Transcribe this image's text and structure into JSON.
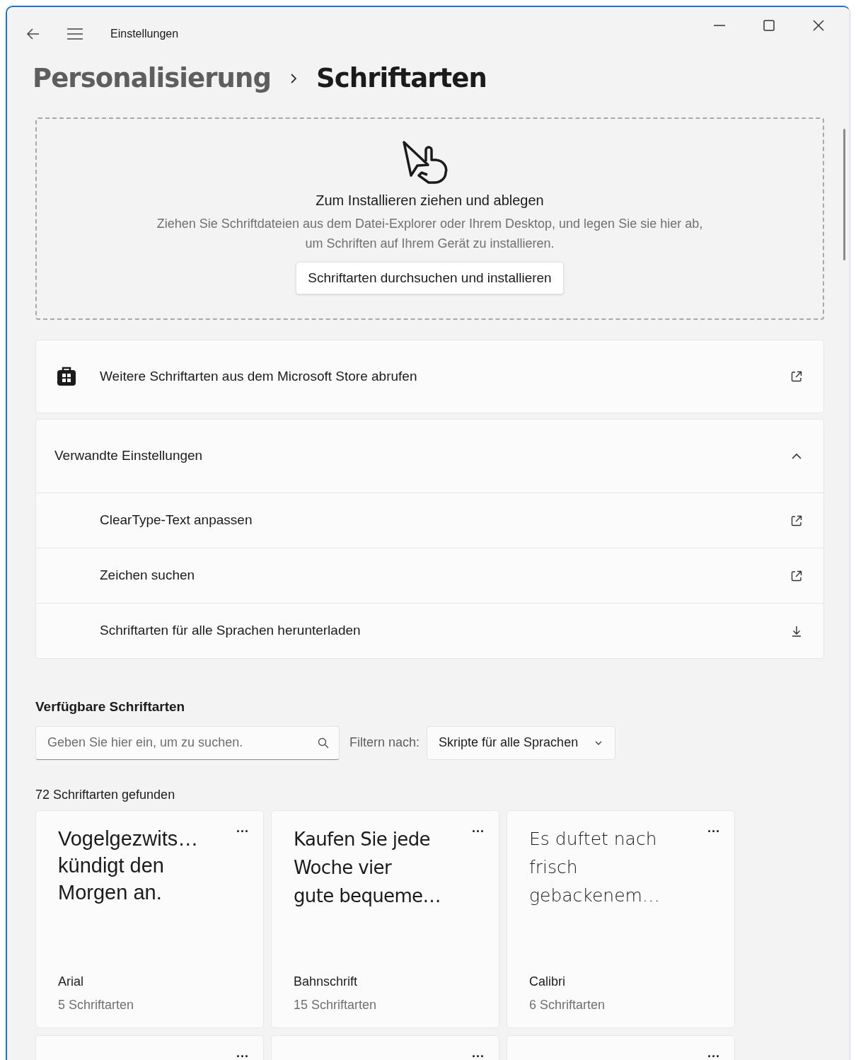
{
  "window": {
    "title": "Einstellungen"
  },
  "breadcrumb": [
    "Personalisierung",
    "Schriftarten"
  ],
  "dropzone": {
    "title": "Zum Installieren ziehen und ablegen",
    "description": "Ziehen Sie Schriftdateien aus dem Datei-Explorer oder Ihrem Desktop, und legen Sie sie hier ab, um Schriften auf Ihrem Gerät zu installieren.",
    "button": "Schriftarten durchsuchen und installieren"
  },
  "store_link": {
    "label": "Weitere Schriftarten aus dem Microsoft Store abrufen"
  },
  "related": {
    "title": "Verwandte Einstellungen",
    "expanded": true,
    "items": [
      {
        "label": "ClearType-Text anpassen",
        "kind": "external"
      },
      {
        "label": "Zeichen suchen",
        "kind": "external"
      },
      {
        "label": "Schriftarten für alle Sprachen herunterladen",
        "kind": "download"
      }
    ]
  },
  "available": {
    "heading": "Verfügbare Schriftarten",
    "search": {
      "placeholder": "Geben Sie hier ein, um zu suchen."
    },
    "filter_label": "Filtern nach:",
    "filter_value": "Skripte für alle Sprachen",
    "count": "72 Schriftarten gefunden"
  },
  "fonts": [
    {
      "preview_lines": [
        "Vogelgezwits…",
        "kündigt den",
        "Morgen an."
      ],
      "menu": "···",
      "name": "Arial",
      "count": "5 Schriftarten"
    },
    {
      "preview_lines": [
        "Kaufen Sie jede",
        "Woche vier",
        "gute bequeme…"
      ],
      "menu": "···",
      "name": "Bahnschrift",
      "count": "15 Schriftarten"
    },
    {
      "preview_lines": [
        "Es duftet nach",
        "frisch",
        "gebackenem…"
      ],
      "menu": "···",
      "name": "Calibri",
      "count": "6 Schriftarten"
    },
    {
      "menu": "···"
    },
    {
      "menu": "···"
    },
    {
      "menu": "···"
    }
  ]
}
